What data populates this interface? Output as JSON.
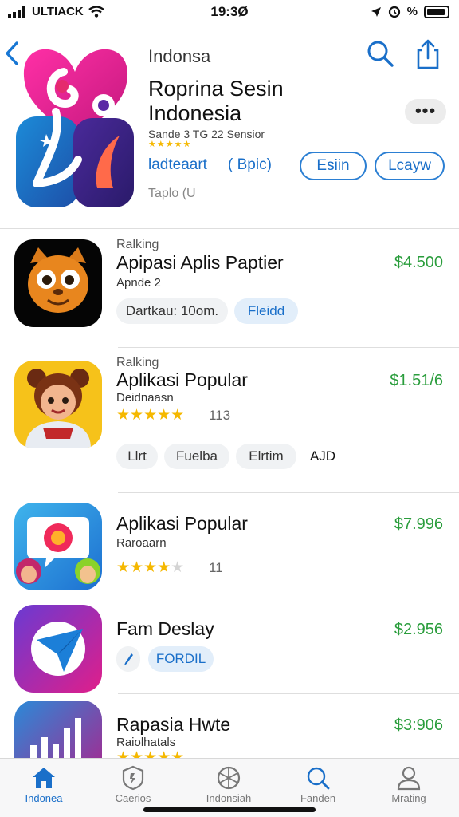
{
  "status_bar": {
    "carrier": "ULTIACK",
    "time": "19:3Ø",
    "battery_label": "%"
  },
  "header": {
    "title": "Indonsa"
  },
  "app": {
    "title_line1": "Roprina Sesin",
    "title_line2": "Indonesia",
    "subtitle": "Sande 3 TG 22 Sensior",
    "link_left": "ladteaart",
    "link_right": "( Bpic)",
    "button_left": "Esiin",
    "button_right": "Lcayw",
    "footer": "Taplo (U",
    "more_label": "•••"
  },
  "rows": [
    {
      "ranking": "Ralking",
      "title": "Apipasi Aplis Paptier",
      "subtitle": "Apnde 2",
      "price": "$4.500",
      "tags": [
        "Dartkau: 10om.",
        "Fleidd"
      ]
    },
    {
      "ranking": "Ralking",
      "title": "Aplikasi Popular",
      "subtitle": "Deidnaasn",
      "price": "$1.51/6",
      "rating": 5,
      "rating_count": "113",
      "tags": [
        "Llrt",
        "Fuelba",
        "Elrtim",
        "AJD"
      ]
    },
    {
      "title": "Aplikasi Popular",
      "subtitle": "Raroaarn",
      "price": "$7.996",
      "rating": 4.5,
      "rating_count": "11"
    },
    {
      "title": "Fam Deslay",
      "price": "$2.956",
      "tags": [
        "FORDIL"
      ]
    },
    {
      "title": "Rapasia Hwte",
      "subtitle": "Raiolhatals",
      "price": "$3:906"
    }
  ],
  "tabs": [
    {
      "label": "Indonea",
      "icon": "home-icon",
      "active": true
    },
    {
      "label": "Caerios",
      "icon": "shield-icon",
      "active": false
    },
    {
      "label": "Indonsiah",
      "icon": "globe-icon",
      "active": false
    },
    {
      "label": "Fanden",
      "icon": "search-icon",
      "active": false
    },
    {
      "label": "Mrating",
      "icon": "person-icon",
      "active": false
    }
  ],
  "colors": {
    "accent": "#1a6fc9",
    "price": "#2a9d3c",
    "star": "#f5b800"
  }
}
